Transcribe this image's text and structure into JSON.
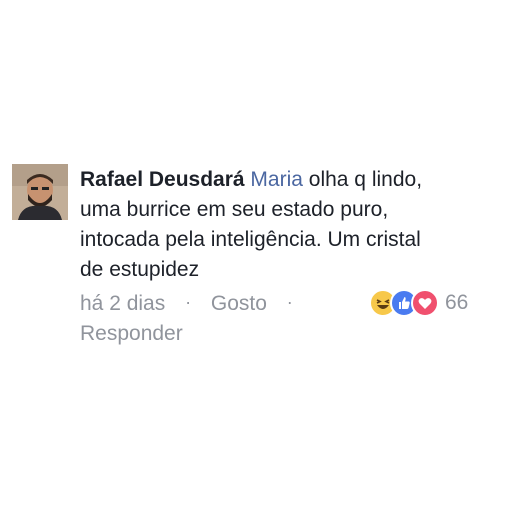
{
  "comment": {
    "author": "Rafael Deusdará",
    "mention": "Maria",
    "text_lines": [
      " olha q lindo,",
      "uma burrice em seu estado puro,",
      "intocada pela inteligência. Um cristal",
      "de estupidez"
    ],
    "time": "há 2 dias",
    "separator": "·",
    "like_label": "Gosto",
    "reply_label": "Responder",
    "reaction_count": "66",
    "reactions": [
      "haha-icon",
      "like-icon",
      "love-icon"
    ]
  },
  "colors": {
    "author": "#1d2129",
    "mention": "#4b67a1",
    "meta": "#90949c",
    "haha": "#f7c84a",
    "like": "#4a7bf0",
    "love": "#f0506e"
  }
}
